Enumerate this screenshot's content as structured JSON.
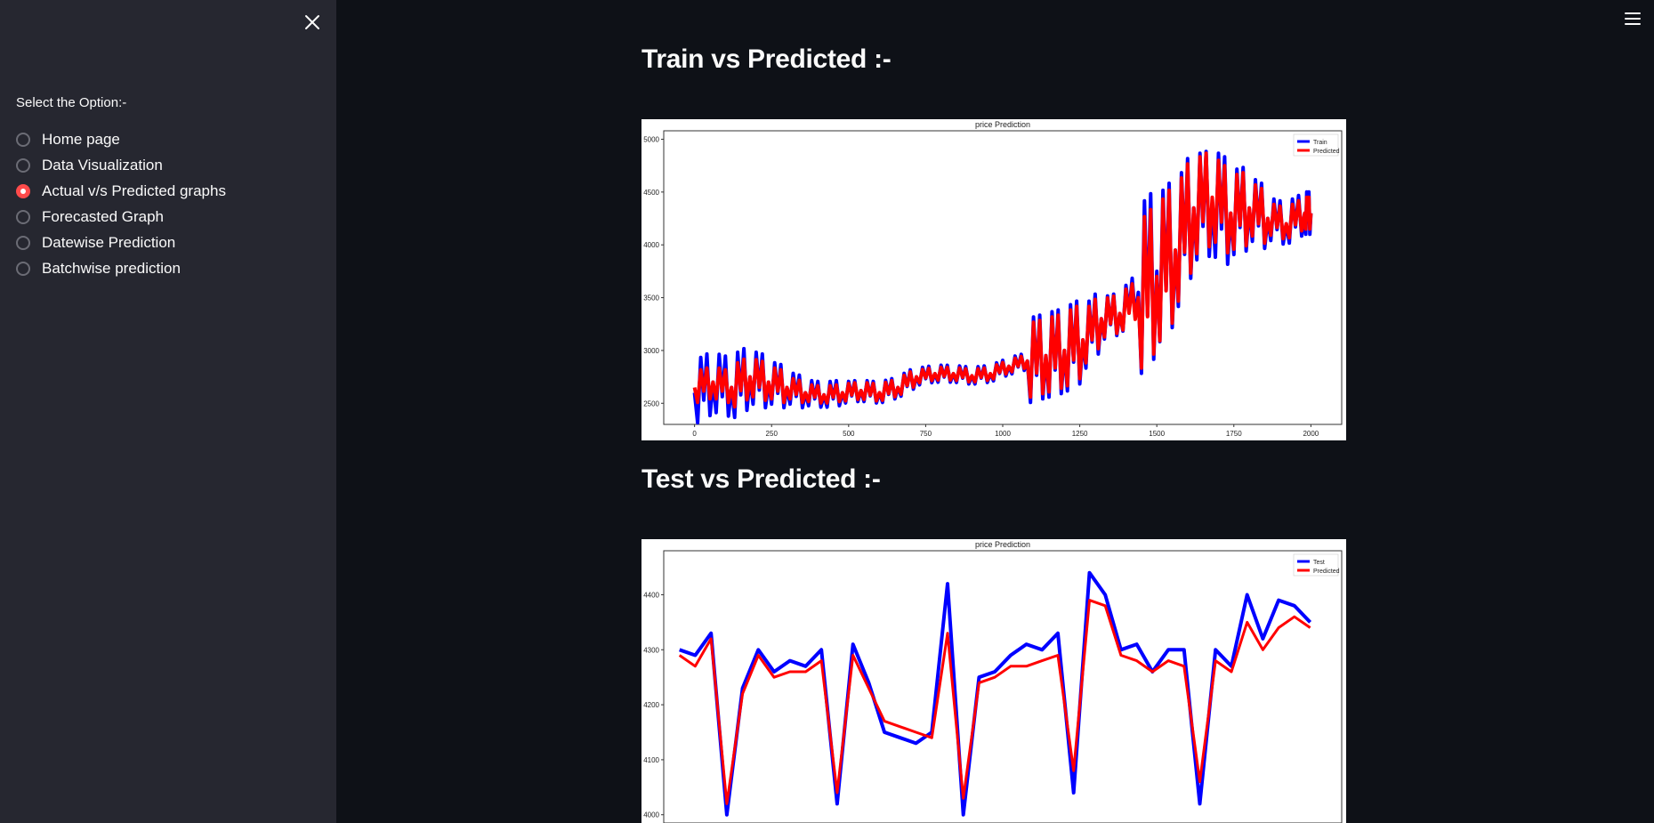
{
  "sidebar": {
    "close_icon": "close-icon",
    "label": "Select the Option:-",
    "options": [
      {
        "label": "Home page",
        "selected": false
      },
      {
        "label": "Data Visualization",
        "selected": false
      },
      {
        "label": "Actual v/s Predicted graphs",
        "selected": true
      },
      {
        "label": "Forecasted Graph",
        "selected": false
      },
      {
        "label": "Datewise Prediction",
        "selected": false
      },
      {
        "label": "Batchwise prediction",
        "selected": false
      }
    ]
  },
  "header": {
    "menu_icon": "hamburger-menu-icon"
  },
  "main": {
    "train_title": "Train vs Predicted :-",
    "test_title": "Test vs Predicted :-"
  },
  "colors": {
    "accent": "#ff4b4b",
    "background": "#0e1117",
    "sidebar": "#262730",
    "series_actual": "#0000ff",
    "series_predicted": "#ff0000"
  },
  "chart_data": [
    {
      "type": "line",
      "title": "price Prediction",
      "xlim": [
        -100,
        2100
      ],
      "ylim": [
        2300,
        5080
      ],
      "xticks": [
        0,
        250,
        500,
        750,
        1000,
        1250,
        1500,
        1750,
        2000
      ],
      "yticks": [
        2500,
        3000,
        3500,
        4000,
        4500,
        5000
      ],
      "legend": "top-right",
      "series": [
        {
          "name": "Train",
          "color": "#0000ff",
          "width": 4,
          "x": [
            0,
            60,
            120,
            180,
            240,
            300,
            360,
            420,
            480,
            540,
            600,
            660,
            720,
            780,
            840,
            900,
            960,
            1020,
            1080,
            1140,
            1200,
            1260,
            1320,
            1380,
            1440,
            1500,
            1560,
            1620,
            1680,
            1740,
            1800,
            1860,
            1920,
            1980,
            2000
          ],
          "y": [
            2600,
            2700,
            2650,
            2750,
            2700,
            2650,
            2600,
            2580,
            2600,
            2620,
            2600,
            2650,
            2750,
            2780,
            2780,
            2760,
            2780,
            2850,
            2900,
            2950,
            3000,
            3100,
            3300,
            3350,
            3550,
            3750,
            3950,
            4350,
            4400,
            4300,
            4350,
            4250,
            4200,
            4300,
            4300
          ],
          "amp": [
            300,
            280,
            300,
            250,
            200,
            150,
            120,
            120,
            100,
            100,
            100,
            100,
            80,
            80,
            80,
            80,
            80,
            80,
            400,
            400,
            400,
            300,
            200,
            200,
            800,
            700,
            600,
            500,
            500,
            400,
            300,
            200,
            200,
            200,
            200
          ]
        },
        {
          "name": "Predicted",
          "color": "#ff0000",
          "width": 4,
          "x": [
            0,
            60,
            120,
            180,
            240,
            300,
            360,
            420,
            480,
            540,
            600,
            660,
            720,
            780,
            840,
            900,
            960,
            1020,
            1080,
            1140,
            1200,
            1260,
            1320,
            1380,
            1440,
            1500,
            1560,
            1620,
            1680,
            1740,
            1800,
            1860,
            1920,
            1980,
            2000
          ],
          "y": [
            2650,
            2700,
            2650,
            2750,
            2700,
            2650,
            2600,
            2580,
            2600,
            2620,
            2600,
            2650,
            2750,
            2780,
            2780,
            2760,
            2780,
            2850,
            2900,
            2950,
            3000,
            3100,
            3300,
            3350,
            3500,
            3700,
            3950,
            4350,
            4450,
            4300,
            4350,
            4250,
            4200,
            4300,
            4300
          ],
          "amp": [
            150,
            150,
            200,
            180,
            150,
            100,
            80,
            80,
            80,
            80,
            80,
            80,
            60,
            60,
            60,
            60,
            60,
            60,
            350,
            350,
            350,
            250,
            180,
            180,
            700,
            650,
            550,
            450,
            400,
            350,
            250,
            150,
            150,
            150,
            150
          ]
        }
      ]
    },
    {
      "type": "line",
      "title": "price Prediction",
      "xlim": [
        -5,
        210
      ],
      "ylim": [
        3985,
        4480
      ],
      "yticks": [
        4000,
        4100,
        4200,
        4300,
        4400
      ],
      "legend": "top-right",
      "series": [
        {
          "name": "Test",
          "color": "#0000ff",
          "width": 4,
          "x": [
            0,
            5,
            10,
            15,
            20,
            25,
            30,
            35,
            40,
            45,
            50,
            55,
            60,
            65,
            70,
            75,
            80,
            85,
            90,
            95,
            100,
            105,
            110,
            115,
            120,
            125,
            130,
            135,
            140,
            145,
            150,
            155,
            160,
            165,
            170,
            175,
            180,
            185,
            190,
            195,
            200
          ],
          "y": [
            4300,
            4290,
            4330,
            4000,
            4230,
            4300,
            4260,
            4280,
            4270,
            4300,
            4020,
            4310,
            4240,
            4150,
            4140,
            4130,
            4150,
            4420,
            4000,
            4250,
            4260,
            4290,
            4310,
            4300,
            4330,
            4040,
            4440,
            4400,
            4300,
            4310,
            4260,
            4300,
            4300,
            4020,
            4300,
            4270,
            4400,
            4320,
            4390,
            4380,
            4350
          ],
          "amp": [
            0,
            0,
            0,
            0,
            0,
            0,
            0,
            0,
            0,
            0,
            0,
            0,
            0,
            0,
            0,
            0,
            0,
            0,
            0,
            0,
            0,
            0,
            0,
            0,
            0,
            0,
            0,
            0,
            0,
            0,
            0,
            0,
            0,
            0,
            0,
            0,
            0,
            0,
            0,
            0,
            0
          ]
        },
        {
          "name": "Predicted",
          "color": "#ff0000",
          "width": 3,
          "x": [
            0,
            5,
            10,
            15,
            20,
            25,
            30,
            35,
            40,
            45,
            50,
            55,
            60,
            65,
            70,
            75,
            80,
            85,
            90,
            95,
            100,
            105,
            110,
            115,
            120,
            125,
            130,
            135,
            140,
            145,
            150,
            155,
            160,
            165,
            170,
            175,
            180,
            185,
            190,
            195,
            200
          ],
          "y": [
            4290,
            4270,
            4320,
            4020,
            4220,
            4290,
            4250,
            4260,
            4260,
            4280,
            4040,
            4290,
            4230,
            4170,
            4160,
            4150,
            4140,
            4330,
            4030,
            4240,
            4250,
            4270,
            4270,
            4280,
            4290,
            4080,
            4390,
            4380,
            4290,
            4280,
            4260,
            4280,
            4270,
            4060,
            4280,
            4260,
            4350,
            4300,
            4340,
            4360,
            4340
          ],
          "amp": [
            0,
            0,
            0,
            0,
            0,
            0,
            0,
            0,
            0,
            0,
            0,
            0,
            0,
            0,
            0,
            0,
            0,
            0,
            0,
            0,
            0,
            0,
            0,
            0,
            0,
            0,
            0,
            0,
            0,
            0,
            0,
            0,
            0,
            0,
            0,
            0,
            0,
            0,
            0,
            0,
            0
          ]
        }
      ]
    }
  ]
}
